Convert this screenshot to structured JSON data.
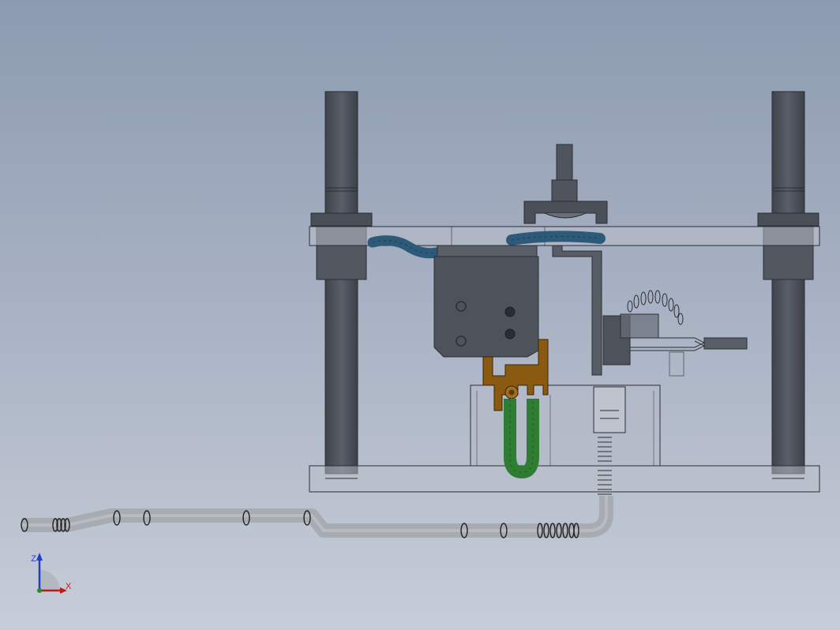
{
  "viewport": {
    "background_top": "#8c9bb0",
    "background_bottom": "#c7cdd8",
    "view": "Front"
  },
  "colors": {
    "frame_gray": "#4f535c",
    "plate_translucent": "#b9bfca",
    "hose_blue": "#2d5a78",
    "hose_green": "#2f7d32",
    "bracket_orange": "#8a5a10",
    "tube_gray": "#a7abb2",
    "axis_x": "#c0191d",
    "axis_z": "#1e3ec8"
  },
  "triad": {
    "z_label": "Z",
    "x_label": "X",
    "icon": "coordinate-triad-icon"
  }
}
